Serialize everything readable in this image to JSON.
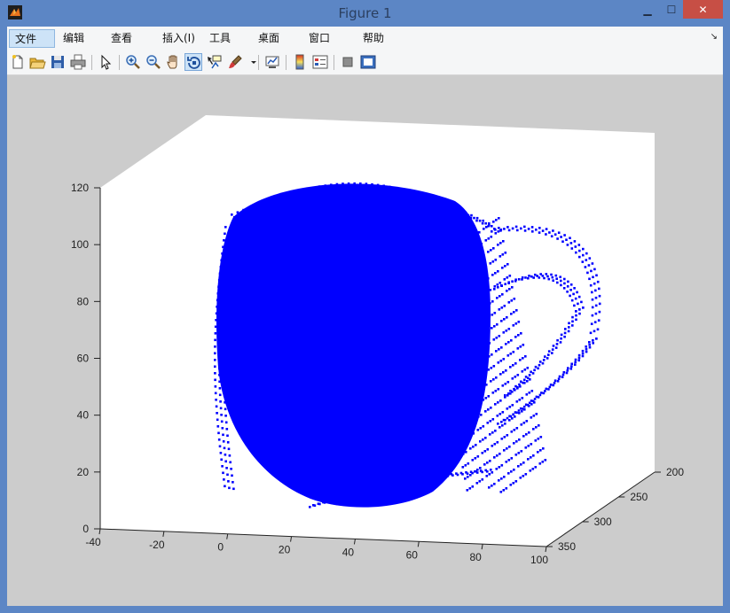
{
  "window": {
    "title": "Figure 1"
  },
  "menu": [
    {
      "label": "文件(F)",
      "active": true
    },
    {
      "label": "编辑(E)"
    },
    {
      "label": "查看(V)"
    },
    {
      "label": "插入(I)"
    },
    {
      "label": "工具(T)"
    },
    {
      "label": "桌面(D)"
    },
    {
      "label": "窗口(W)"
    },
    {
      "label": "帮助(H)"
    }
  ],
  "toolbar": [
    {
      "name": "new-figure-icon"
    },
    {
      "name": "open-file-icon"
    },
    {
      "name": "save-icon"
    },
    {
      "name": "print-icon"
    },
    {
      "name": "edit-plot-arrow-icon"
    },
    {
      "name": "zoom-in-icon"
    },
    {
      "name": "zoom-out-icon"
    },
    {
      "name": "pan-hand-icon"
    },
    {
      "name": "rotate-3d-icon",
      "pressed": true
    },
    {
      "name": "data-cursor-icon"
    },
    {
      "name": "brush-icon"
    },
    {
      "name": "brush-dropdown-icon"
    },
    {
      "name": "link-plot-icon"
    },
    {
      "name": "colorbar-icon"
    },
    {
      "name": "legend-icon"
    },
    {
      "name": "hide-plot-tools-icon"
    },
    {
      "name": "show-plot-tools-icon"
    }
  ],
  "chart_data": {
    "type": "scatter",
    "subtype": "3d",
    "title": "",
    "color": "#0000ff",
    "marker": "point",
    "x_ticks": [
      "-40",
      "-20",
      "0",
      "20",
      "40",
      "60",
      "80",
      "100"
    ],
    "y_ticks": [
      "200",
      "250",
      "300",
      "350"
    ],
    "z_ticks": [
      "0",
      "20",
      "40",
      "60",
      "80",
      "100",
      "120"
    ],
    "xlim": [
      -40,
      100
    ],
    "ylim": [
      200,
      350
    ],
    "zlim": [
      0,
      120
    ],
    "grid": false,
    "legend": "none",
    "shape": "point cloud of a mug with a handle on the +x side",
    "mug": {
      "body_x_range": [
        0,
        80
      ],
      "body_z_range": [
        5,
        115
      ],
      "handle_z_range": [
        30,
        105
      ]
    }
  },
  "colors": {
    "window_frame": "#5c86c5",
    "figure_background": "#cccccc",
    "axes_background": "#ffffff",
    "points": "#0000ff",
    "close_button": "#c74f45"
  }
}
